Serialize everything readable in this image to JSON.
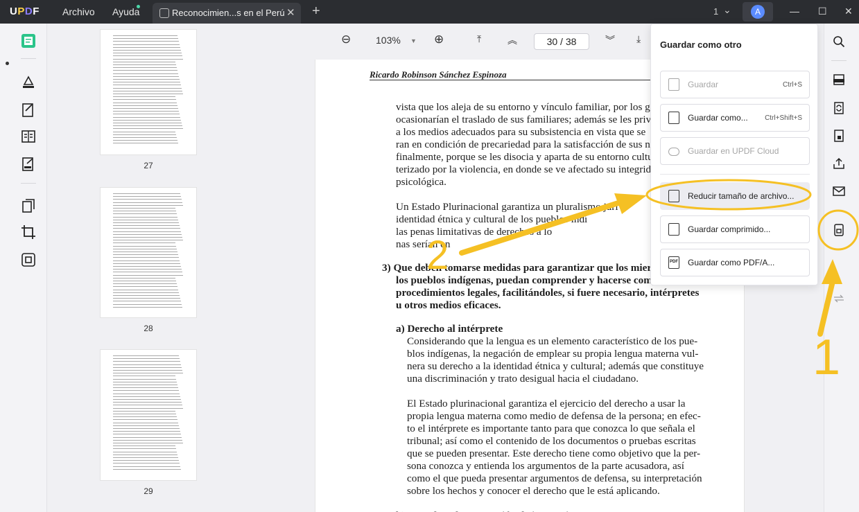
{
  "app": {
    "logo": "UPDF"
  },
  "menu": {
    "file": "Archivo",
    "help": "Ayuda"
  },
  "tab": {
    "title": "Reconocimien...s en el Perú",
    "close": "✕",
    "new": "+"
  },
  "window": {
    "count": "1",
    "avatar": "A",
    "minimize": "—",
    "maximize": "☐",
    "close": "✕"
  },
  "viewer": {
    "zoom": "103%",
    "page": "30 / 38",
    "zoom_out": "⊖",
    "zoom_in": "⊕"
  },
  "thumbnails": [
    {
      "page": "27"
    },
    {
      "page": "28"
    },
    {
      "page": "29"
    }
  ],
  "document": {
    "header": "Ricardo Robinson Sánchez Espinoza",
    "lines": [
      "vista que los aleja de su entorno y vínculo familiar, por los g",
      "ocasionarían el traslado de sus familiares; además se les priva d",
      "a los medios adecuados para su subsistencia en vista que se",
      "ran en condición de precariedad para la satisfacción de sus nec",
      "finalmente, porque se les disocia y aparta de su entorno cultu",
      "terizado por la violencia, en donde se ve afectado su integridad",
      "psicológica.",
      "Un Estado Plurinacional garantiza un pluralismo juri",
      "identidad étnica y cultural de los pueblos indí",
      "las penas limitativas de derechos a lo",
      "nas serían en",
      "3) Que deben tomarse medidas para garantizar  que los mier",
      "los pueblos indígenas, puedan comprender y hacerse compr",
      "procedimientos legales, facilitándoles, si fuere necesario, intérpretes",
      "u otros medios eficaces.",
      "a) Derecho al intérprete",
      "Considerando que la lengua es un elemento característico de los pue-",
      "blos indígenas, la negación de emplear su propia lengua materna vul-",
      "nera su derecho a la identidad étnica y cultural; además que constituye",
      "una discriminación y trato desigual hacia el ciudadano.",
      "El Estado plurinacional garantiza el ejercicio del derecho a usar la",
      "propia lengua materna como medio de defensa de la persona; en efec-",
      "to el intérprete es importante tanto para que conozca lo que señala el",
      "tribunal; así como el contenido de los documentos o pruebas escritas",
      "que se pueden presentar. Este derecho tiene como objetivo que la per-",
      "sona conozca y entienda los argumentos de la parte acusadora, así",
      "como el que pueda presentar argumentos de defensa, su interpretación",
      "sobre los hechos y conocer el derecho que le está aplicando.",
      "b) Derecho a la presunción de inocencia"
    ]
  },
  "save_menu": {
    "title": "Guardar como otro",
    "save": "Guardar",
    "save_shortcut": "Ctrl+S",
    "save_as": "Guardar como...",
    "save_as_shortcut": "Ctrl+Shift+S",
    "save_cloud": "Guardar en UPDF Cloud",
    "reduce": "Reducir tamaño de archivo...",
    "compressed": "Guardar comprimido...",
    "pdfa": "Guardar como PDF/A..."
  },
  "annotations": {
    "step1": "1",
    "step2": "2",
    "color": "#f5c024"
  }
}
